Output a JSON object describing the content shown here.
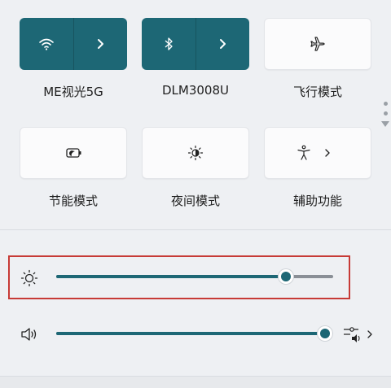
{
  "tiles": [
    {
      "label": "ME视光5G",
      "icon": "wifi-icon",
      "active": true,
      "split": true
    },
    {
      "label": "DLM3008U",
      "icon": "bluetooth-icon",
      "active": true,
      "split": true
    },
    {
      "label": "飞行模式",
      "icon": "airplane-icon",
      "active": false,
      "split": false
    },
    {
      "label": "节能模式",
      "icon": "battery-saver-icon",
      "active": false,
      "split": false
    },
    {
      "label": "夜间模式",
      "icon": "night-light-icon",
      "active": false,
      "split": false
    },
    {
      "label": "辅助功能",
      "icon": "accessibility-icon",
      "active": false,
      "split": true
    }
  ],
  "brightness": {
    "percent": 0.83
  },
  "volume": {
    "percent": 0.97
  },
  "colors": {
    "accent": "#1d6775",
    "highlight": "#c73a36",
    "background": "#eef0f3"
  }
}
